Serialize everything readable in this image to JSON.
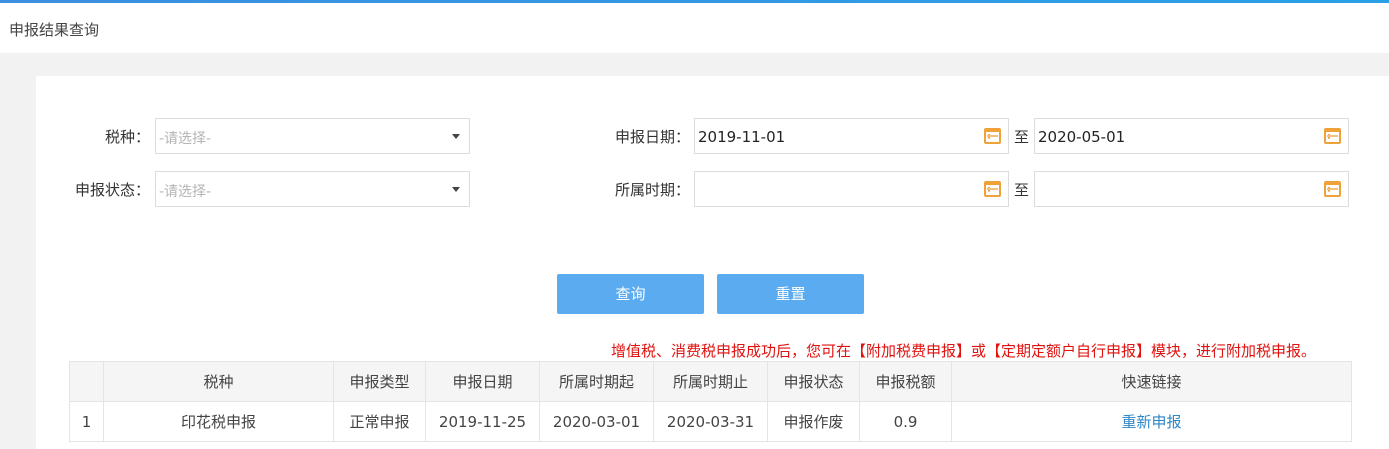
{
  "page": {
    "title": "申报结果查询"
  },
  "form": {
    "tax_type": {
      "label": "税种：",
      "placeholder": "-请选择-"
    },
    "status": {
      "label": "申报状态：",
      "placeholder": "-请选择-"
    },
    "declare_date": {
      "label": "申报日期：",
      "from": "2019-11-01",
      "to_label": "至",
      "to": "2020-05-01"
    },
    "period": {
      "label": "所属时期：",
      "from": "",
      "to_label": "至",
      "to": ""
    }
  },
  "buttons": {
    "query": "查询",
    "reset": "重置"
  },
  "notice": "增值税、消费税申报成功后，您可在【附加税费申报】或【定期定额户自行申报】模块，进行附加税申报。",
  "table": {
    "headers": [
      "",
      "税种",
      "申报类型",
      "申报日期",
      "所属时期起",
      "所属时期止",
      "申报状态",
      "申报税额",
      "快速链接"
    ],
    "rows": [
      [
        "1",
        "印花税申报",
        "正常申报",
        "2019-11-25",
        "2020-03-01",
        "2020-03-31",
        "申报作废",
        "0.9",
        "重新申报"
      ]
    ]
  },
  "colors": {
    "accent": "#5aabf0",
    "notice": "#e0120f",
    "link": "#2f87c8",
    "calendar": "#f0a23a"
  },
  "icons": {
    "select_caret": "caret-down-icon",
    "date_picker": "calendar-icon"
  }
}
